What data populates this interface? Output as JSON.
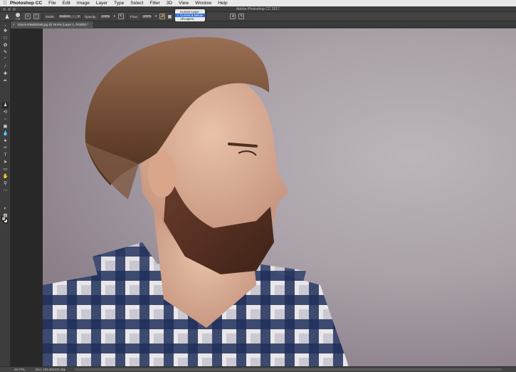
{
  "menubar": {
    "app_name": "Photoshop CC",
    "items": [
      "File",
      "Edit",
      "Image",
      "Layer",
      "Type",
      "Select",
      "Filter",
      "3D",
      "View",
      "Window",
      "Help"
    ]
  },
  "window": {
    "title": "Adobe Photoshop CC 2017"
  },
  "options_bar": {
    "brush_size": "175",
    "mode_label": "Mode:",
    "mode_value": "Darken",
    "opacity_label": "Opacity:",
    "opacity_value": "100%",
    "flow_label": "Flow:",
    "flow_value": "100%",
    "aligned_label": "Aligned",
    "sample_label": "Sample:"
  },
  "sample_menu": {
    "items": [
      "Current Layer",
      "Current & Below",
      "All Layers"
    ],
    "selected_index": 1
  },
  "document_tab": {
    "title": "iStock-636830290.jpg @ 26.8% (Layer 1, RGB/8) *"
  },
  "status": {
    "zoom": "26.77%",
    "doc": "Doc: 103.4M/103.4M"
  },
  "colors": {
    "foreground": "#d8b89a",
    "background": "#ffffff",
    "highlight": "#2b6fd6"
  },
  "toolbar_icons": [
    "move-icon",
    "marquee-icon",
    "lasso-icon",
    "quick-select-icon",
    "crop-icon",
    "eyedropper-icon",
    "healing-icon",
    "brush-icon",
    "clone-stamp-icon",
    "history-brush-icon",
    "eraser-icon",
    "gradient-icon",
    "blur-icon",
    "dodge-icon",
    "pen-icon",
    "type-icon",
    "path-select-icon",
    "shape-icon",
    "hand-icon",
    "zoom-icon",
    "more-icon"
  ]
}
